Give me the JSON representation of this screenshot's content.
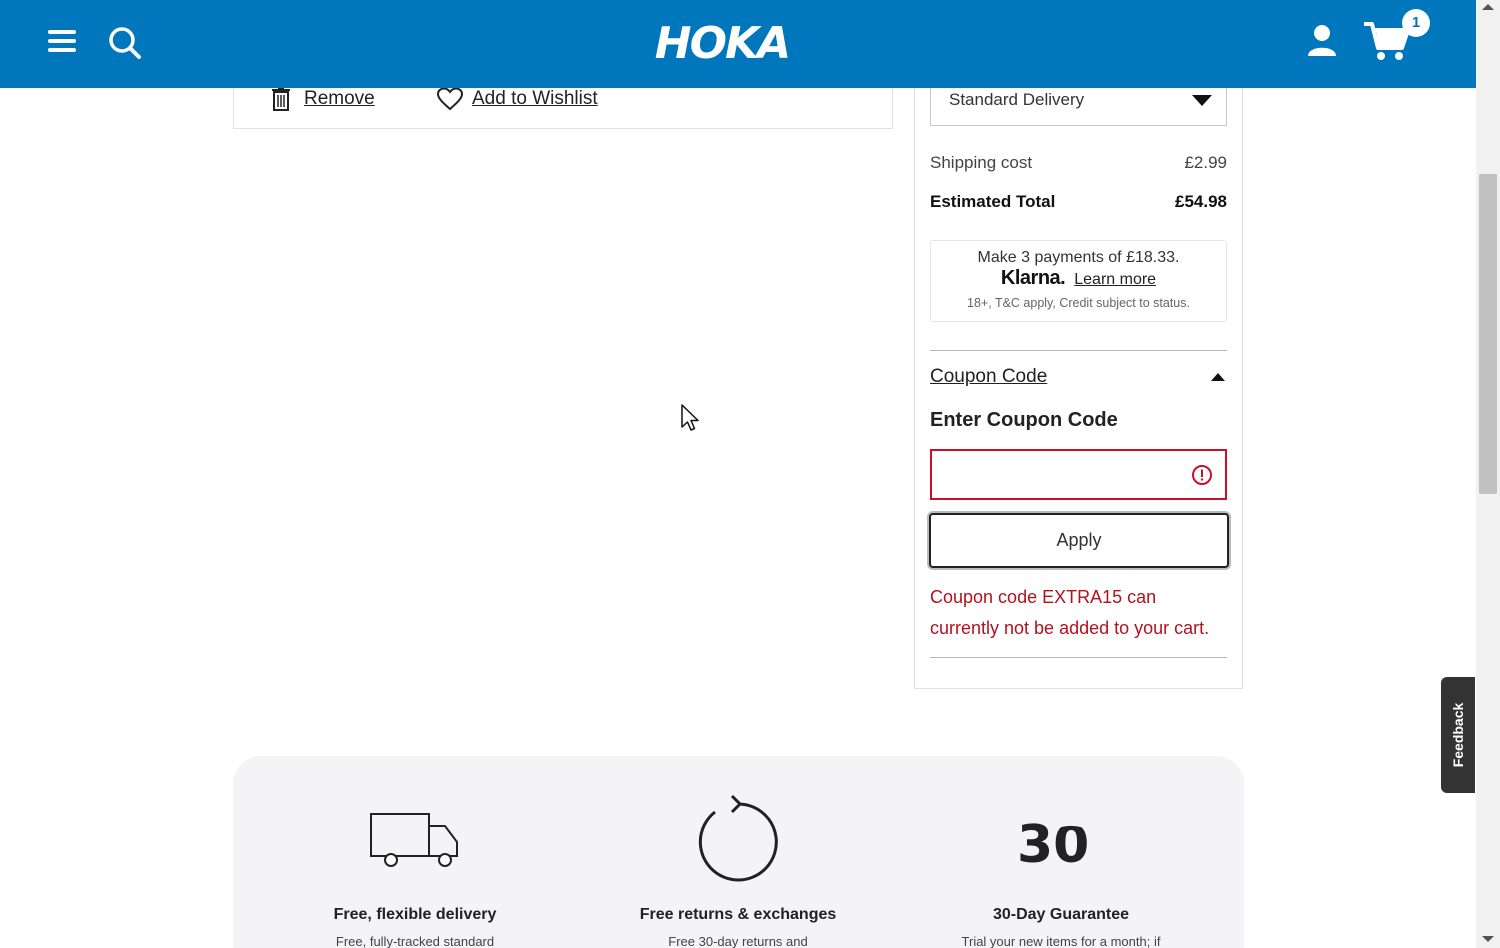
{
  "header": {
    "logo_text": "HOKA",
    "cart_count": "1",
    "brand_color": "#0076bd"
  },
  "item_actions": {
    "remove_label": "Remove",
    "wishlist_label": "Add to Wishlist"
  },
  "summary": {
    "delivery_option": "Standard Delivery",
    "shipping_label": "Shipping cost",
    "shipping_value": "£2.99",
    "total_label": "Estimated Total",
    "total_value": "£54.98",
    "klarna": {
      "line1": "Make 3 payments of £18.33.",
      "brand": "Klarna.",
      "learn_more": "Learn more",
      "disclaimer": "18+, T&C apply, Credit subject to status."
    },
    "coupon": {
      "toggle_label": "Coupon Code",
      "title": "Enter Coupon Code",
      "input_value": "",
      "apply_label": "Apply",
      "error_message": "Coupon code EXTRA15 can currently not be added to your cart.",
      "error_color": "#b3111d"
    }
  },
  "benefits": [
    {
      "icon": "delivery-truck-icon",
      "title": "Free, flexible delivery",
      "desc": "Free, fully-tracked standard"
    },
    {
      "icon": "returns-arrow-icon",
      "title": "Free returns & exchanges",
      "desc": "Free 30-day returns and"
    },
    {
      "icon": "thirty-day-icon",
      "title": "30-Day Guarantee",
      "desc": "Trial your new items for a month; if"
    }
  ],
  "feedback_label": "Feedback"
}
